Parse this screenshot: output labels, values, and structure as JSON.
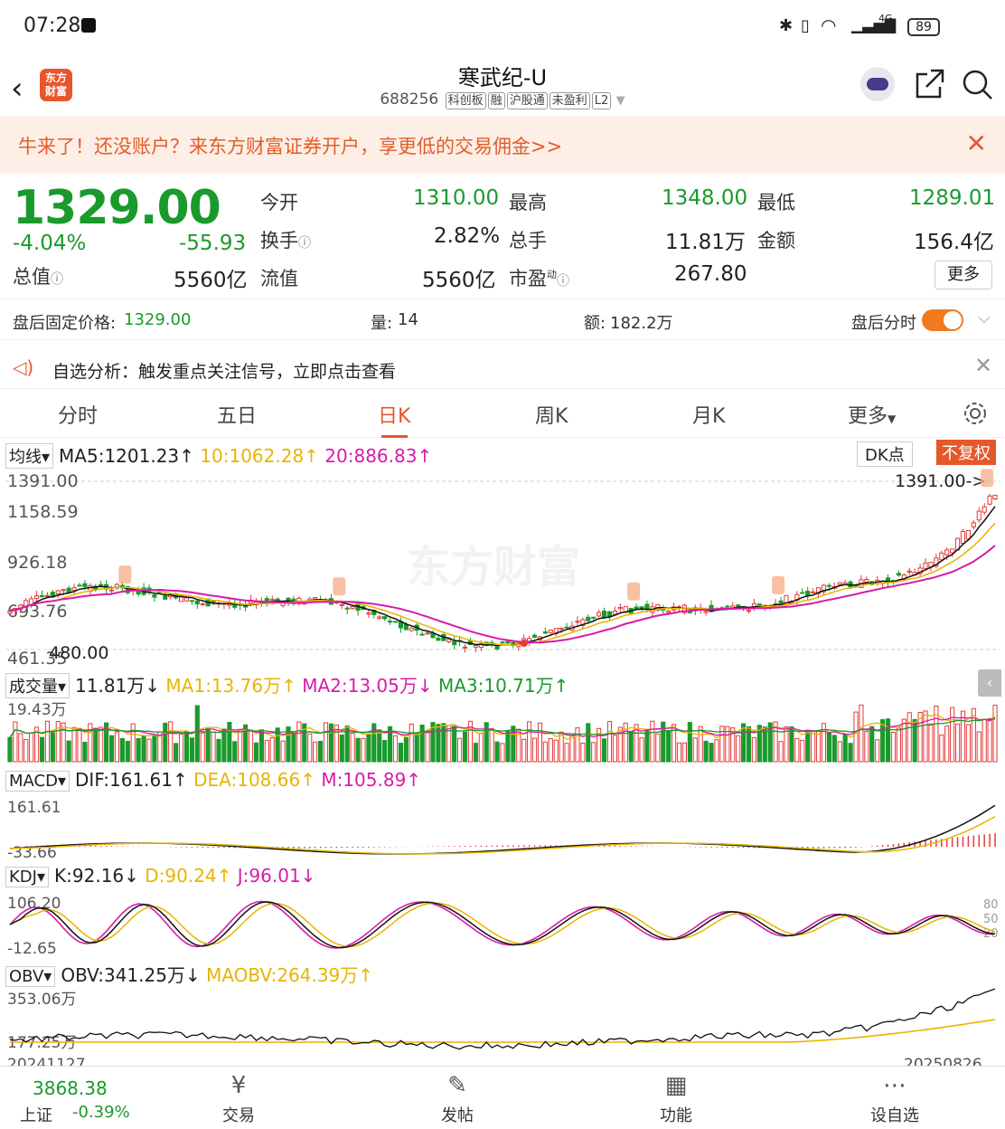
{
  "status": {
    "time": "07:28",
    "battery": "89",
    "signal": "4G"
  },
  "header": {
    "title": "寒武纪-U",
    "code": "688256",
    "tags": [
      "科创板",
      "融",
      "沪股通",
      "未盈利",
      "L2"
    ],
    "logo_text": "东方财富"
  },
  "banner": {
    "text": "牛来了！还没账户？来东方财富证券开户，享更低的交易佣金>>"
  },
  "quote": {
    "price": "1329.00",
    "change_pct": "-4.04%",
    "change": "-55.93",
    "open_label": "今开",
    "open": "1310.00",
    "high_label": "最高",
    "high": "1348.00",
    "low_label": "最低",
    "low": "1289.01",
    "turnover_label": "换手",
    "turnover": "2.82%",
    "volume_label": "总手",
    "volume": "11.81万",
    "amount_label": "金额",
    "amount": "156.4亿",
    "mcap_label": "总值",
    "mcap": "5560亿",
    "float_label": "流值",
    "float": "5560亿",
    "pe_label": "市盈",
    "pe_sup": "动",
    "pe": "267.80",
    "more": "更多"
  },
  "after_hours": {
    "price_label": "盘后固定价格:",
    "price": "1329.00",
    "vol_label": "量:",
    "vol": "14",
    "amt_label": "额:",
    "amt": "182.2万",
    "timeshare_label": "盘后分时"
  },
  "analysis": {
    "text": "自选分析：触发重点关注信号，立即点击查看"
  },
  "tabs": [
    "分时",
    "五日",
    "日K",
    "周K",
    "月K",
    "更多"
  ],
  "kline": {
    "indicator": "均线",
    "ma5": "MA5:1201.23↑",
    "ma10": "10:1062.28↑",
    "ma20": "20:886.83↑",
    "dk": "DK点",
    "adjust": "不复权",
    "axis": [
      "1391.00",
      "1158.59",
      "926.18",
      "693.76",
      "461.35"
    ],
    "max_label": "1391.00->",
    "min_label": "480.00",
    "watermark": "东方财富"
  },
  "volume": {
    "name": "成交量",
    "value": "11.81万↓",
    "ma1": "MA1:13.76万↑",
    "ma2": "MA2:13.05万↓",
    "ma3": "MA3:10.71万↑",
    "axis_top": "19.43万"
  },
  "macd": {
    "name": "MACD",
    "dif": "DIF:161.61↑",
    "dea": "DEA:108.66↑",
    "m": "M:105.89↑",
    "axis_top": "161.61",
    "axis_bottom": "-33.66"
  },
  "kdj": {
    "name": "KDJ",
    "k": "K:92.16↓",
    "d": "D:90.24↑",
    "j": "J:96.01↓",
    "axis_top": "106.20",
    "axis_bottom": "-12.65",
    "levels": [
      "80",
      "50",
      "20"
    ]
  },
  "obv": {
    "name": "OBV",
    "obv": "OBV:341.25万↓",
    "maobv": "MAOBV:264.39万↑",
    "axis_top": "353.06万",
    "axis_bottom": "177.25万",
    "date_start": "20241127",
    "date_end": "20250826"
  },
  "bottom_nav": {
    "index_value": "3868.38",
    "index_name": "上证",
    "index_change": "-0.39%",
    "items": [
      "交易",
      "发帖",
      "功能",
      "设自选"
    ]
  },
  "colors": {
    "up": "#e63a3a",
    "down": "#1a9a2c",
    "accent": "#e5582a",
    "ma10": "#e8b400",
    "ma20": "#d81ba8"
  }
}
